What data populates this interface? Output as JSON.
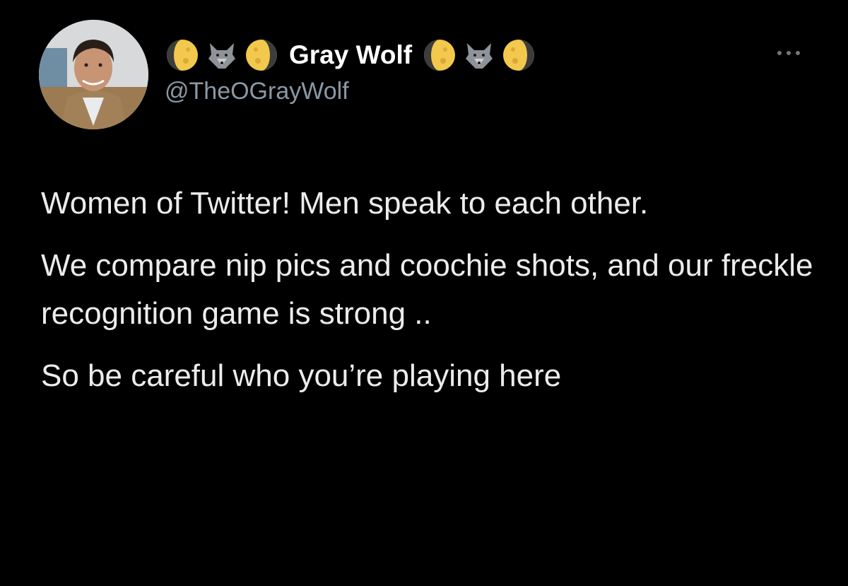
{
  "author": {
    "display_name": "Gray Wolf",
    "handle": "@TheOGrayWolf",
    "name_prefix_icons": [
      "waxing-gibbous-moon-icon",
      "wolf-icon",
      "waning-gibbous-moon-icon"
    ],
    "name_suffix_icons": [
      "waxing-gibbous-moon-icon",
      "wolf-icon",
      "waning-gibbous-moon-icon"
    ]
  },
  "more_button": {
    "icon": "more-horizontal-icon"
  },
  "tweet": {
    "paragraphs": [
      "Women of Twitter!  Men speak to each other.",
      "We compare nip pics and coochie shots, and our freckle recognition game is strong ..",
      "So be careful who you’re playing here"
    ]
  },
  "colors": {
    "background": "#000000",
    "text": "#e7e9ea",
    "secondary_text": "#8b98a5",
    "moon": "#f2c94c"
  }
}
